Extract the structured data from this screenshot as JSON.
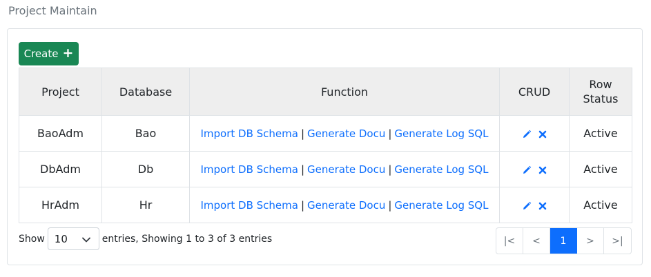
{
  "page": {
    "title": "Project Maintain"
  },
  "toolbar": {
    "create_label": "Create"
  },
  "table": {
    "headers": {
      "project": "Project",
      "database": "Database",
      "function": "Function",
      "crud": "CRUD",
      "status": "Row Status"
    },
    "function_links": [
      "Import DB Schema",
      "Generate Docu",
      "Generate Log SQL"
    ],
    "separator": "|",
    "rows": [
      {
        "project": "BaoAdm",
        "database": "Bao",
        "status": "Active"
      },
      {
        "project": "DbAdm",
        "database": "Db",
        "status": "Active"
      },
      {
        "project": "HrAdm",
        "database": "Hr",
        "status": "Active"
      }
    ]
  },
  "footer": {
    "show_label": "Show",
    "page_size": "10",
    "entries_text": "entries, Showing 1 to 3 of 3 entries"
  },
  "pagination": {
    "first": "|<",
    "prev": "<",
    "current": "1",
    "next": ">",
    "last": ">|"
  },
  "colors": {
    "primary": "#0d6efd",
    "create": "#198754",
    "header_bg": "#eeeeee"
  },
  "icons": {
    "edit": "pencil-icon",
    "delete": "close-icon",
    "create": "plus-icon",
    "select": "chevron-down-icon"
  }
}
